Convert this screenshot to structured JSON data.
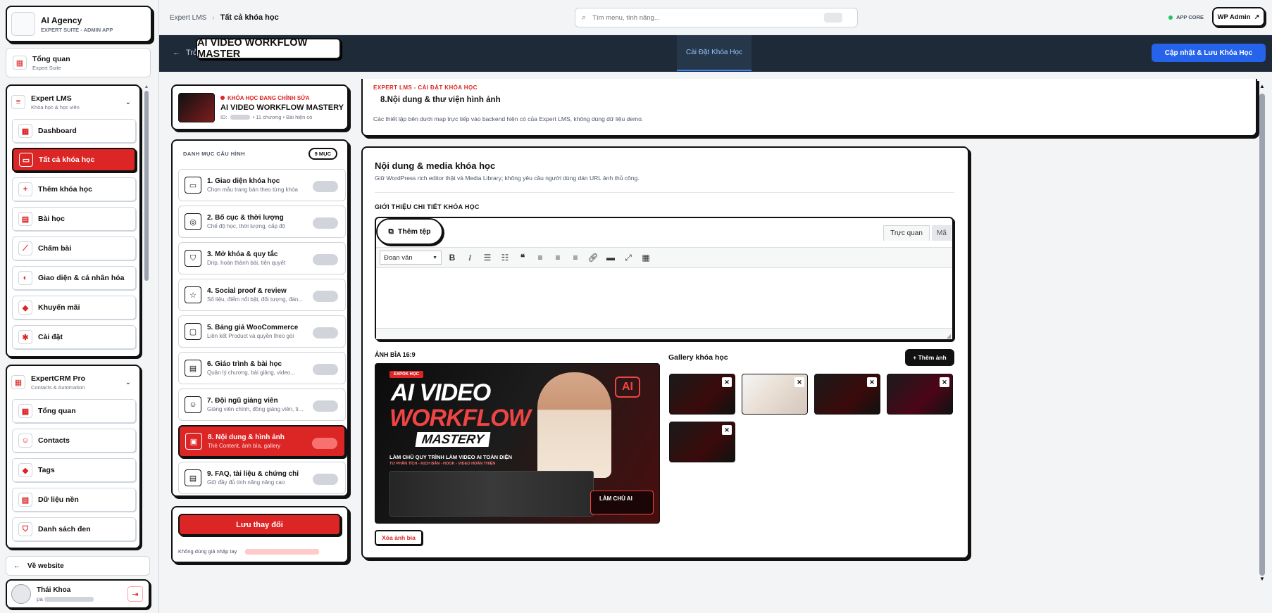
{
  "app": {
    "title": "AI Agency",
    "subtitle": "EXPERT SUITE - ADMIN APP"
  },
  "sidebar": {
    "overview": {
      "label": "Tổng quan",
      "sub": "Expert Suite"
    },
    "lms": {
      "label": "Expert LMS",
      "sub": "Khóa học & học viên"
    },
    "lms_items": [
      "Dashboard",
      "Tất cả khóa học",
      "Thêm khóa học",
      "Bài học",
      "Chấm bài",
      "Giao diện & cá nhân hóa",
      "Khuyến mãi",
      "Cài đặt"
    ],
    "crm": {
      "label": "ExpertCRM Pro",
      "sub": "Contacts & Automation"
    },
    "crm_items": [
      "Tổng quan",
      "Contacts",
      "Tags",
      "Dữ liệu nền",
      "Danh sách đen"
    ],
    "back_link": "Về website",
    "user": {
      "name": "Thái Khoa",
      "email": "pa"
    }
  },
  "topbar": {
    "breadcrumb_root": "Expert LMS",
    "breadcrumb_current": "Tất cả khóa học",
    "search_placeholder": "Tìm menu, tính năng...",
    "status": "APP CORE",
    "wp_admin": "WP Admin"
  },
  "darkbar": {
    "back": "Trở lại",
    "course_title": "AI VIDEO WORKFLOW MASTER",
    "tab": "Cài Đặt Khóa Học",
    "save_button": "Cập nhật & Lưu Khóa Học"
  },
  "course_card": {
    "badge": "KHÓA HỌC ĐANG CHỈNH SỬA",
    "title": "AI VIDEO WORKFLOW MASTERY",
    "id_label": "ID:",
    "meta": "• 11 chương • Bài hiện có"
  },
  "config": {
    "header": "DANH MỤC CẤU HÌNH",
    "count": "9 MỤC",
    "items": [
      {
        "title": "1. Giao diện khóa học",
        "sub": "Chọn mẫu trang bán theo từng khóa"
      },
      {
        "title": "2. Bố cục & thời lượng",
        "sub": "Chế độ học, thời lượng, cấp độ"
      },
      {
        "title": "3. Mở khóa & quy tắc",
        "sub": "Drip, hoàn thành bài, tiện quyết"
      },
      {
        "title": "4. Social proof & review",
        "sub": "Số liệu, điểm nổi bật, đối tượng, đán..."
      },
      {
        "title": "5. Bảng giá WooCommerce",
        "sub": "Liên kết Product và quyền theo gói"
      },
      {
        "title": "6. Giáo trình & bài học",
        "sub": "Quản lý chương, bài giảng, video..."
      },
      {
        "title": "7. Đội ngũ giảng viên",
        "sub": "Giảng viên chính, đồng giảng viên, tì..."
      },
      {
        "title": "8. Nội dung & hình ảnh",
        "sub": "Thẻ Content, ảnh bìa, gallery"
      },
      {
        "title": "9. FAQ, tài liệu & chứng chỉ",
        "sub": "Giữ đầy đủ tính năng nâng cao"
      }
    ],
    "active_index": 7,
    "save_button": "Lưu thay đổi",
    "note": "Không dùng giá nhập tay"
  },
  "section_header": {
    "kicker": "EXPERT LMS - CÀI ĐẶT KHÓA HỌC",
    "title": "8.Nội dung & thư viện hình ảnh",
    "desc": "Các thiết lập bên dưới map trực tiếp vào backend hiện có của Expert LMS, không dùng dữ liệu demo."
  },
  "media": {
    "title": "Nội dung & media khóa học",
    "desc": "Giữ WordPress rich editor thật và Media Library; không yêu cầu người dùng dán URL ảnh thủ công.",
    "intro_label": "GIỚI THIỆU CHI TIẾT KHÓA HỌC",
    "add_file": "Thêm tệp",
    "tab_visual": "Trực quan",
    "tab_code": "Mã",
    "format_select": "Đoạn văn",
    "cover_label": "ẢNH BÌA 16:9",
    "gallery_label": "Gallery khóa học",
    "add_image": "+ Thêm ảnh",
    "remove_cover": "Xóa ảnh bìa",
    "cover_art": {
      "badge": "EXPOK HỌC",
      "line1": "AI VIDEO",
      "line2": "WORKFLOW",
      "line3": "MASTERY",
      "tagline": "LÀM CHỦ QUY TRÌNH LÀM VIDEO AI TOÀN DIỆN",
      "sub_tagline": "TƯ PHÂN TÍCH - KỊCH BẢN - HOOK - VIDEO HOÀN THIỆN",
      "ai_mark": "AI",
      "cta": "LÀM CHỦ AI"
    }
  },
  "colors": {
    "accent": "#dc2626",
    "dark": "#1e2a38",
    "primary": "#2563eb"
  }
}
